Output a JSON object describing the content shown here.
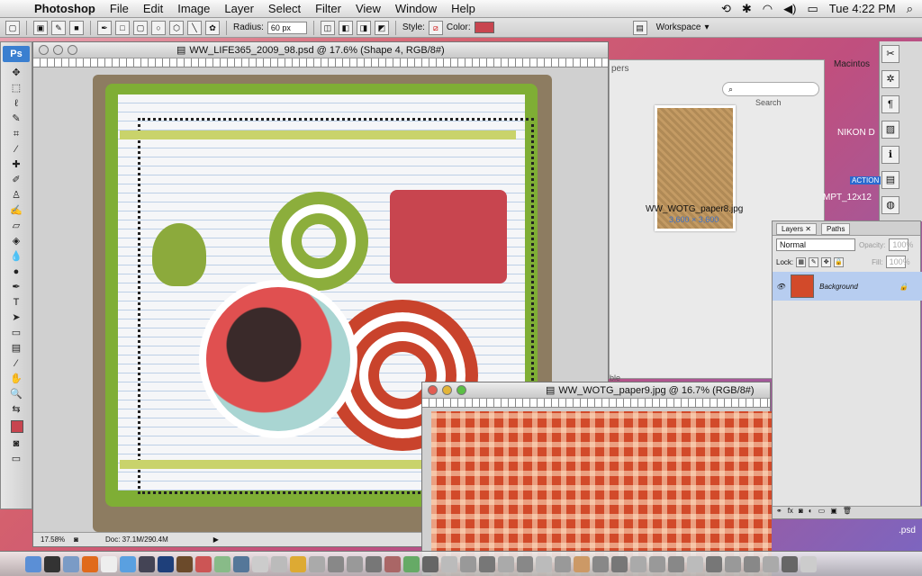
{
  "menubar": {
    "app": "Photoshop",
    "items": [
      "File",
      "Edit",
      "Image",
      "Layer",
      "Select",
      "Filter",
      "View",
      "Window",
      "Help"
    ],
    "clock": "Tue 4:22 PM"
  },
  "options": {
    "radius_label": "Radius:",
    "radius_value": "60 px",
    "style_label": "Style:",
    "color_label": "Color:",
    "color": "#c8454f",
    "workspace": "Workspace"
  },
  "toolbox": {
    "logo": "Ps"
  },
  "doc1": {
    "title": "WW_LIFE365_2009_98.psd @ 17.6% (Shape 4, RGB/8#)",
    "zoom": "17.58%",
    "doc_size": "Doc: 37.1M/290.4M"
  },
  "bridge": {
    "search_label": "Search",
    "partial_title": "pers",
    "file_name": "WW_WOTG_paper8.jpg",
    "file_dims": "3,600 × 3,600",
    "partial_label": "ble"
  },
  "doc2": {
    "title": "WW_WOTG_paper9.jpg @ 16.7% (RGB/8#)"
  },
  "layers": {
    "tab1": "Layers",
    "tab2": "Paths",
    "blend": "Normal",
    "opacity_label": "Opacity:",
    "opacity": "100%",
    "lock_label": "Lock:",
    "fill_label": "Fill:",
    "fill": "100%",
    "layer_name": "Background"
  },
  "desktop": {
    "label1": "Macintos",
    "label2": "NIKON D",
    "label3": "ACTION",
    "label4": "MPT_12x12",
    "label5": ".psd"
  }
}
